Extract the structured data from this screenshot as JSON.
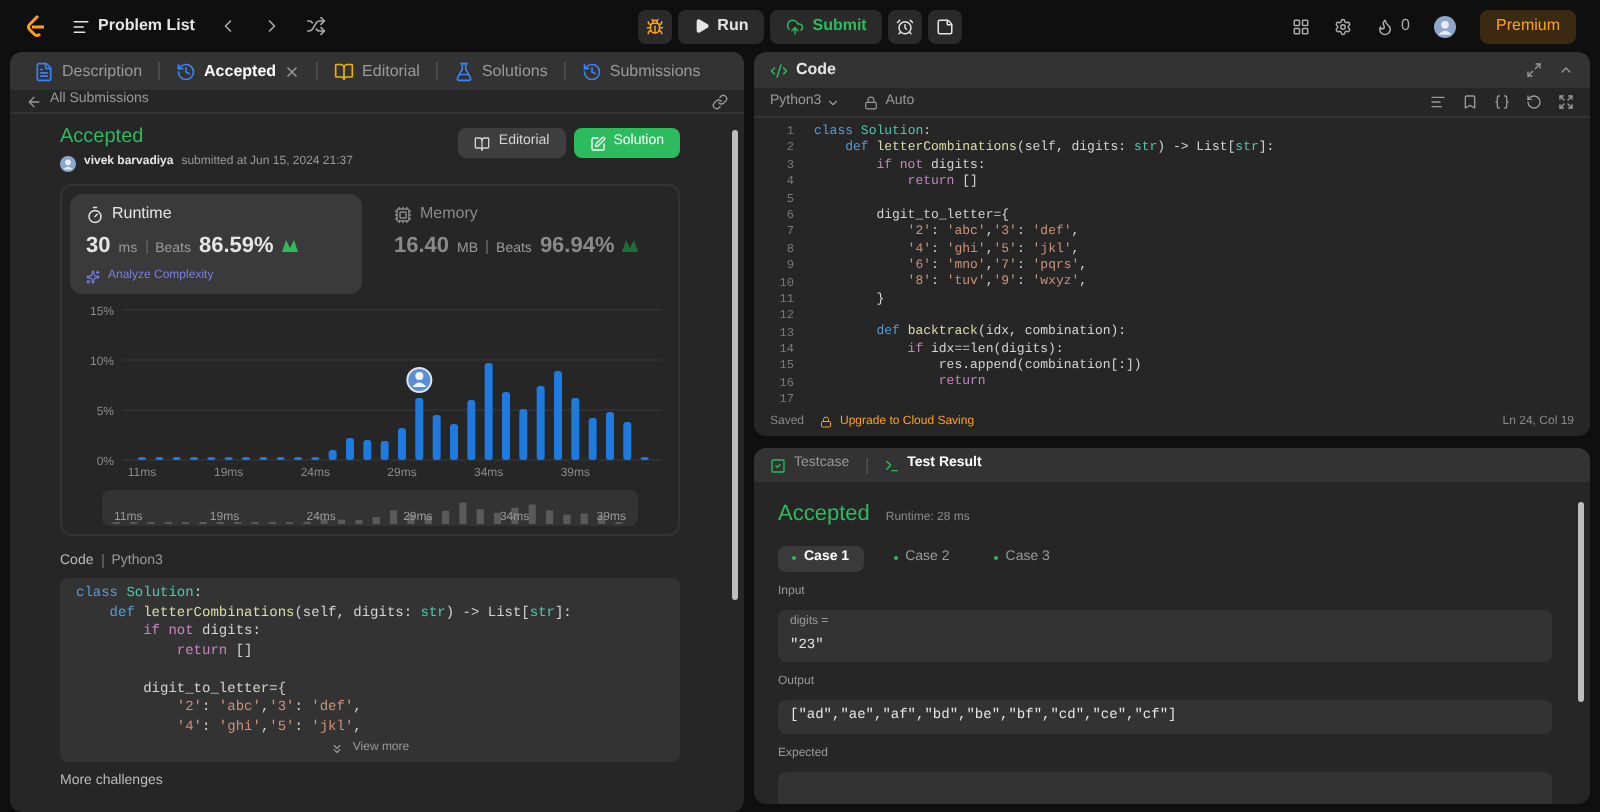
{
  "top_bar": {
    "problem_list": "Problem List",
    "run": "Run",
    "submit": "Submit",
    "streak": "0",
    "premium": "Premium"
  },
  "left_tabs": [
    {
      "label": "Description",
      "selected": false,
      "closable": false
    },
    {
      "label": "Accepted",
      "selected": true,
      "closable": true
    },
    {
      "label": "Editorial",
      "selected": false,
      "closable": false
    },
    {
      "label": "Solutions",
      "selected": false,
      "closable": false
    },
    {
      "label": "Submissions",
      "selected": false,
      "closable": false
    }
  ],
  "back_link": "All Submissions",
  "submission": {
    "status": "Accepted",
    "user": "vivek barvadiya",
    "meta": "submitted at Jun 15, 2024 21:37",
    "buttons": [
      {
        "label": "Editorial",
        "kind": "secondary"
      },
      {
        "label": "Solution",
        "kind": "primary"
      }
    ]
  },
  "stats": [
    {
      "kind": "runtime",
      "label": "Runtime",
      "value": "30",
      "unit": "ms",
      "beats_label": "Beats",
      "beats": "86.59%",
      "selected": true,
      "link": "Analyze Complexity"
    },
    {
      "kind": "memory",
      "label": "Memory",
      "value": "16.40",
      "unit": "MB",
      "beats_label": "Beats",
      "beats": "96.94%",
      "selected": false
    }
  ],
  "chart_data": {
    "type": "bar",
    "categories": [
      "11ms",
      null,
      null,
      null,
      null,
      "19ms",
      null,
      null,
      null,
      null,
      "24ms",
      null,
      null,
      null,
      null,
      "29ms",
      null,
      null,
      null,
      null,
      "34ms",
      null,
      null,
      null,
      null,
      "39ms",
      null,
      null,
      null,
      null
    ],
    "values": [
      0.3,
      0.3,
      0.3,
      0.3,
      0.3,
      0.3,
      0.3,
      0.3,
      0.3,
      0.3,
      0.3,
      1,
      2.2,
      2,
      1.9,
      3.2,
      6.2,
      4.5,
      3.6,
      6,
      9.7,
      6.8,
      5.1,
      7.4,
      8.9,
      6.2,
      4.2,
      4.8,
      3.8,
      0.3
    ],
    "yticks": [
      {
        "value": 0,
        "label": "0%"
      },
      {
        "value": 5,
        "label": "5%"
      },
      {
        "value": 10,
        "label": "10%"
      },
      {
        "value": 15,
        "label": "15%"
      }
    ],
    "ylim": [
      0,
      15
    ]
  },
  "overview_labels": [
    "11ms",
    "19ms",
    "24ms",
    "29ms",
    "34ms",
    "39ms"
  ],
  "code_section": {
    "title": "Code",
    "language": "Python3",
    "view_more": "View more",
    "lines": [
      {
        "kind": "code",
        "tokens": [
          {
            "text": "class",
            "kind": "keyword"
          },
          {
            "text": " Solution",
            "kind": "type"
          },
          {
            "text": ":",
            "kind": "plain"
          }
        ]
      },
      {
        "kind": "code",
        "tokens": [
          {
            "text": "    def",
            "kind": "keyword"
          },
          {
            "text": " letterCombinations",
            "kind": "function"
          },
          {
            "text": "(self, digits: ",
            "kind": "plain"
          },
          {
            "text": "str",
            "kind": "type"
          },
          {
            "text": ") -> List[",
            "kind": "plain"
          },
          {
            "text": "str",
            "kind": "type"
          },
          {
            "text": "]:",
            "kind": "plain"
          }
        ]
      },
      {
        "kind": "code",
        "tokens": [
          {
            "text": "        if not",
            "kind": "control"
          },
          {
            "text": " digits:",
            "kind": "plain"
          }
        ]
      },
      {
        "kind": "code",
        "tokens": [
          {
            "text": "            return",
            "kind": "control"
          },
          {
            "text": " []",
            "kind": "plain"
          }
        ]
      },
      {
        "kind": "blank"
      },
      {
        "kind": "code",
        "tokens": [
          {
            "text": "        digit_to_letter={",
            "kind": "plain"
          }
        ]
      },
      {
        "kind": "code",
        "tokens": [
          {
            "text": "            '2'",
            "kind": "string"
          },
          {
            "text": ": ",
            "kind": "plain"
          },
          {
            "text": "'abc'",
            "kind": "string"
          },
          {
            "text": ",",
            "kind": "plain"
          },
          {
            "text": "'3'",
            "kind": "string"
          },
          {
            "text": ": ",
            "kind": "plain"
          },
          {
            "text": "'def'",
            "kind": "string"
          },
          {
            "text": ",",
            "kind": "plain"
          }
        ]
      },
      {
        "kind": "code",
        "tokens": [
          {
            "text": "            '4'",
            "kind": "string"
          },
          {
            "text": ": ",
            "kind": "plain"
          },
          {
            "text": "'ghi'",
            "kind": "string"
          },
          {
            "text": ",",
            "kind": "plain"
          },
          {
            "text": "'5'",
            "kind": "string"
          },
          {
            "text": ": ",
            "kind": "plain"
          },
          {
            "text": "'jkl'",
            "kind": "string"
          },
          {
            "text": ",",
            "kind": "plain"
          }
        ]
      }
    ]
  },
  "more_challenges": "More challenges",
  "editor": {
    "title": "Code",
    "language": "Python3",
    "mode": "Auto",
    "saved": "Saved",
    "upgrade": "Upgrade to Cloud Saving",
    "cursor": "Ln 24, Col 19",
    "lines": [
      {
        "no": "1",
        "tokens": [
          {
            "text": "class",
            "kind": "keyword"
          },
          {
            "text": " Solution",
            "kind": "type"
          },
          {
            "text": ":",
            "kind": "plain"
          }
        ]
      },
      {
        "no": "2",
        "tokens": [
          {
            "text": "    def",
            "kind": "keyword"
          },
          {
            "text": " letterCombinations",
            "kind": "function"
          },
          {
            "text": "(self, digits: ",
            "kind": "plain"
          },
          {
            "text": "str",
            "kind": "type"
          },
          {
            "text": ") -> List[",
            "kind": "plain"
          },
          {
            "text": "str",
            "kind": "type"
          },
          {
            "text": "]:",
            "kind": "plain"
          }
        ]
      },
      {
        "no": "3",
        "tokens": [
          {
            "text": "        if not",
            "kind": "control"
          },
          {
            "text": " digits:",
            "kind": "plain"
          }
        ]
      },
      {
        "no": "4",
        "tokens": [
          {
            "text": "            return",
            "kind": "control"
          },
          {
            "text": " []",
            "kind": "plain"
          }
        ]
      },
      {
        "no": "5"
      },
      {
        "no": "6",
        "tokens": [
          {
            "text": "        digit_to_letter={",
            "kind": "plain"
          }
        ]
      },
      {
        "no": "7",
        "tokens": [
          {
            "text": "            '2'",
            "kind": "string"
          },
          {
            "text": ": ",
            "kind": "plain"
          },
          {
            "text": "'abc'",
            "kind": "string"
          },
          {
            "text": ",",
            "kind": "plain"
          },
          {
            "text": "'3'",
            "kind": "string"
          },
          {
            "text": ": ",
            "kind": "plain"
          },
          {
            "text": "'def'",
            "kind": "string"
          },
          {
            "text": ",",
            "kind": "plain"
          }
        ]
      },
      {
        "no": "8",
        "tokens": [
          {
            "text": "            '4'",
            "kind": "string"
          },
          {
            "text": ": ",
            "kind": "plain"
          },
          {
            "text": "'ghi'",
            "kind": "string"
          },
          {
            "text": ",",
            "kind": "plain"
          },
          {
            "text": "'5'",
            "kind": "string"
          },
          {
            "text": ": ",
            "kind": "plain"
          },
          {
            "text": "'jkl'",
            "kind": "string"
          },
          {
            "text": ",",
            "kind": "plain"
          }
        ]
      },
      {
        "no": "9",
        "tokens": [
          {
            "text": "            '6'",
            "kind": "string"
          },
          {
            "text": ": ",
            "kind": "plain"
          },
          {
            "text": "'mno'",
            "kind": "string"
          },
          {
            "text": ",",
            "kind": "plain"
          },
          {
            "text": "'7'",
            "kind": "string"
          },
          {
            "text": ": ",
            "kind": "plain"
          },
          {
            "text": "'pqrs'",
            "kind": "string"
          },
          {
            "text": ",",
            "kind": "plain"
          }
        ]
      },
      {
        "no": "10",
        "tokens": [
          {
            "text": "            '8'",
            "kind": "string"
          },
          {
            "text": ": ",
            "kind": "plain"
          },
          {
            "text": "'tuv'",
            "kind": "string"
          },
          {
            "text": ",",
            "kind": "plain"
          },
          {
            "text": "'9'",
            "kind": "string"
          },
          {
            "text": ": ",
            "kind": "plain"
          },
          {
            "text": "'wxyz'",
            "kind": "string"
          },
          {
            "text": ",",
            "kind": "plain"
          }
        ]
      },
      {
        "no": "11",
        "tokens": [
          {
            "text": "        }",
            "kind": "plain"
          }
        ]
      },
      {
        "no": "12"
      },
      {
        "no": "13",
        "tokens": [
          {
            "text": "        def",
            "kind": "keyword"
          },
          {
            "text": " backtrack",
            "kind": "function"
          },
          {
            "text": "(idx, combination):",
            "kind": "plain"
          }
        ]
      },
      {
        "no": "14",
        "tokens": [
          {
            "text": "            if",
            "kind": "control"
          },
          {
            "text": " idx==len(digits):",
            "kind": "plain"
          }
        ]
      },
      {
        "no": "15",
        "tokens": [
          {
            "text": "                res.append(combination[:])",
            "kind": "plain"
          }
        ]
      },
      {
        "no": "16",
        "tokens": [
          {
            "text": "                return",
            "kind": "control"
          }
        ]
      },
      {
        "no": "17"
      }
    ]
  },
  "test_tabs": [
    {
      "label": "Testcase",
      "selected": false
    },
    {
      "label": "Test Result",
      "selected": true
    }
  ],
  "result": {
    "status": "Accepted",
    "runtime": "Runtime: 28 ms",
    "cases": [
      {
        "label": "Case 1",
        "selected": true
      },
      {
        "label": "Case 2",
        "selected": false
      },
      {
        "label": "Case 3",
        "selected": false
      }
    ],
    "input_label": "Input",
    "param": "digits =",
    "input_value": "\"23\"",
    "output_label": "Output",
    "output_value": "[\"ad\",\"ae\",\"af\",\"bd\",\"be\",\"bf\",\"cd\",\"ce\",\"cf\"]",
    "expected_label": "Expected"
  }
}
